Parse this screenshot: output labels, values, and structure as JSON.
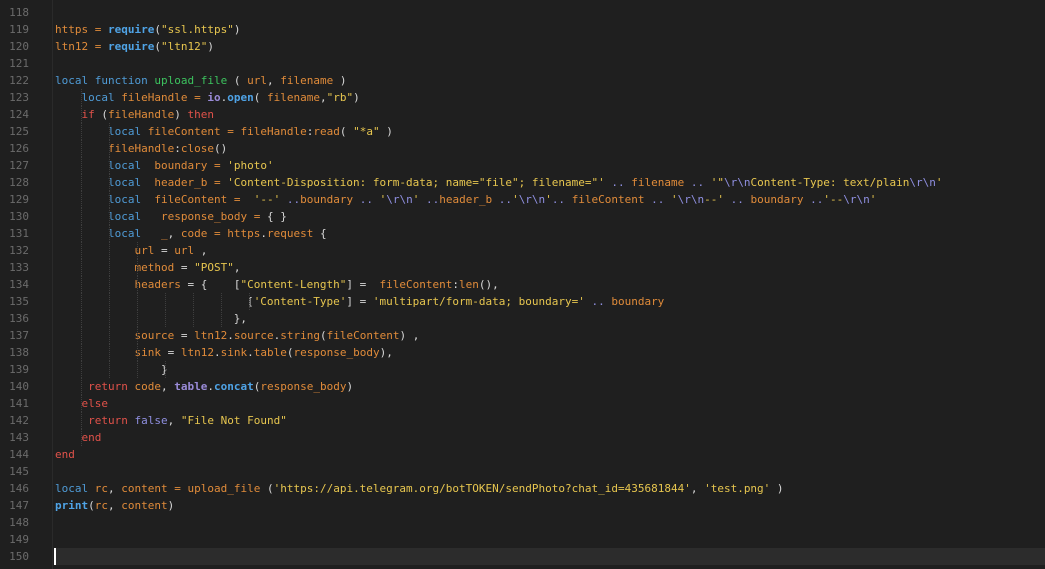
{
  "editor": {
    "language": "lua",
    "current_line": "150",
    "line_numbers": [
      "118",
      "119",
      "120",
      "121",
      "122",
      "123",
      "124",
      "125",
      "126",
      "127",
      "128",
      "129",
      "130",
      "131",
      "132",
      "133",
      "134",
      "135",
      "136",
      "137",
      "138",
      "139",
      "140",
      "141",
      "142",
      "143",
      "144",
      "145",
      "146",
      "147",
      "148",
      "149",
      "150"
    ],
    "token_colors": {
      "keyword": "#4f9bd6",
      "control_keyword": "#e0524a",
      "variable": "#e08b3a",
      "string": "#e7c64f",
      "function_name": "#3cc25e",
      "builtin": "#4fa3e6",
      "library": "#9a8bd8",
      "escape_and_concat": "#8f8fe0",
      "plain": "#d8d8d8"
    },
    "lines": [
      {
        "indent": 0,
        "tokens": []
      },
      {
        "indent": 0,
        "tokens": [
          [
            "var",
            "https"
          ],
          [
            "var",
            " = "
          ],
          [
            "bi",
            "require"
          ],
          [
            "plain",
            "("
          ],
          [
            "str",
            "\"ssl.https\""
          ],
          [
            "plain",
            ")"
          ]
        ]
      },
      {
        "indent": 0,
        "tokens": [
          [
            "var",
            "ltn12"
          ],
          [
            "var",
            " = "
          ],
          [
            "bi",
            "require"
          ],
          [
            "plain",
            "("
          ],
          [
            "str",
            "\"ltn12\""
          ],
          [
            "plain",
            ")"
          ]
        ]
      },
      {
        "indent": 0,
        "tokens": []
      },
      {
        "indent": 0,
        "tokens": [
          [
            "kw",
            "local"
          ],
          [
            "plain",
            " "
          ],
          [
            "kw",
            "function"
          ],
          [
            "plain",
            " "
          ],
          [
            "fn",
            "upload_file"
          ],
          [
            "plain",
            " ( "
          ],
          [
            "var",
            "url"
          ],
          [
            "plain",
            ", "
          ],
          [
            "var",
            "filename"
          ],
          [
            "plain",
            " )"
          ]
        ]
      },
      {
        "indent": 1,
        "tokens": [
          [
            "plain",
            "    "
          ],
          [
            "kw",
            "local"
          ],
          [
            "plain",
            " "
          ],
          [
            "var",
            "fileHandle"
          ],
          [
            "var",
            " = "
          ],
          [
            "lib",
            "io"
          ],
          [
            "plain",
            "."
          ],
          [
            "bi",
            "open"
          ],
          [
            "plain",
            "( "
          ],
          [
            "var",
            "filename"
          ],
          [
            "plain",
            ","
          ],
          [
            "str",
            "\"rb\""
          ],
          [
            "plain",
            ")"
          ]
        ]
      },
      {
        "indent": 1,
        "tokens": [
          [
            "plain",
            "    "
          ],
          [
            "kwr",
            "if"
          ],
          [
            "plain",
            " ("
          ],
          [
            "var",
            "fileHandle"
          ],
          [
            "plain",
            ") "
          ],
          [
            "kwr",
            "then"
          ]
        ]
      },
      {
        "indent": 2,
        "tokens": [
          [
            "plain",
            "        "
          ],
          [
            "kw",
            "local"
          ],
          [
            "plain",
            " "
          ],
          [
            "var",
            "fileContent"
          ],
          [
            "var",
            " = "
          ],
          [
            "var",
            "fileHandle"
          ],
          [
            "plain",
            ":"
          ],
          [
            "var",
            "read"
          ],
          [
            "plain",
            "( "
          ],
          [
            "str",
            "\"*a\""
          ],
          [
            "plain",
            " )"
          ]
        ]
      },
      {
        "indent": 2,
        "tokens": [
          [
            "plain",
            "        "
          ],
          [
            "var",
            "fileHandle"
          ],
          [
            "plain",
            ":"
          ],
          [
            "var",
            "close"
          ],
          [
            "plain",
            "()"
          ]
        ]
      },
      {
        "indent": 2,
        "tokens": [
          [
            "plain",
            "        "
          ],
          [
            "kw",
            "local"
          ],
          [
            "plain",
            "  "
          ],
          [
            "var",
            "boundary"
          ],
          [
            "var",
            " = "
          ],
          [
            "str",
            "'photo'"
          ]
        ]
      },
      {
        "indent": 2,
        "tokens": [
          [
            "plain",
            "        "
          ],
          [
            "kw",
            "local"
          ],
          [
            "plain",
            "  "
          ],
          [
            "var",
            "header_b"
          ],
          [
            "var",
            " = "
          ],
          [
            "str",
            "'Content-Disposition: form-data; name=\"file\"; filename=\"'"
          ],
          [
            "cat",
            " .. "
          ],
          [
            "var",
            "filename"
          ],
          [
            "cat",
            " .. "
          ],
          [
            "str",
            "'\""
          ],
          [
            "esc",
            "\\r\\n"
          ],
          [
            "str",
            "Content-Type: text/plain"
          ],
          [
            "esc",
            "\\r\\n"
          ],
          [
            "str",
            "'"
          ]
        ]
      },
      {
        "indent": 2,
        "tokens": [
          [
            "plain",
            "        "
          ],
          [
            "kw",
            "local"
          ],
          [
            "plain",
            "  "
          ],
          [
            "var",
            "fileContent"
          ],
          [
            "var",
            " =  "
          ],
          [
            "str",
            "'--'"
          ],
          [
            "cat",
            " .."
          ],
          [
            "var",
            "boundary"
          ],
          [
            "cat",
            " .. "
          ],
          [
            "str",
            "'"
          ],
          [
            "esc",
            "\\r\\n"
          ],
          [
            "str",
            "'"
          ],
          [
            "cat",
            " .."
          ],
          [
            "var",
            "header_b"
          ],
          [
            "cat",
            " .."
          ],
          [
            "str",
            "'"
          ],
          [
            "esc",
            "\\r\\n"
          ],
          [
            "str",
            "'"
          ],
          [
            "cat",
            ".. "
          ],
          [
            "var",
            "fileContent"
          ],
          [
            "cat",
            " .. "
          ],
          [
            "str",
            "'"
          ],
          [
            "esc",
            "\\r\\n"
          ],
          [
            "str",
            "--'"
          ],
          [
            "cat",
            " .. "
          ],
          [
            "var",
            "boundary"
          ],
          [
            "cat",
            " .."
          ],
          [
            "str",
            "'--"
          ],
          [
            "esc",
            "\\r\\n"
          ],
          [
            "str",
            "'"
          ]
        ]
      },
      {
        "indent": 2,
        "tokens": [
          [
            "plain",
            "        "
          ],
          [
            "kw",
            "local"
          ],
          [
            "plain",
            "   "
          ],
          [
            "var",
            "response_body"
          ],
          [
            "var",
            " = "
          ],
          [
            "plain",
            "{ }"
          ]
        ]
      },
      {
        "indent": 2,
        "tokens": [
          [
            "plain",
            "        "
          ],
          [
            "kw",
            "local"
          ],
          [
            "plain",
            "   "
          ],
          [
            "var",
            "_"
          ],
          [
            "plain",
            ", "
          ],
          [
            "var",
            "code"
          ],
          [
            "var",
            " = "
          ],
          [
            "var",
            "https"
          ],
          [
            "plain",
            "."
          ],
          [
            "var",
            "request"
          ],
          [
            "plain",
            " {"
          ]
        ]
      },
      {
        "indent": 3,
        "tokens": [
          [
            "plain",
            "            "
          ],
          [
            "var",
            "url"
          ],
          [
            "plain",
            " = "
          ],
          [
            "var",
            "url"
          ],
          [
            "plain",
            " ,"
          ]
        ]
      },
      {
        "indent": 3,
        "tokens": [
          [
            "plain",
            "            "
          ],
          [
            "var",
            "method"
          ],
          [
            "plain",
            " = "
          ],
          [
            "str",
            "\"POST\""
          ],
          [
            "plain",
            ","
          ]
        ]
      },
      {
        "indent": 3,
        "tokens": [
          [
            "plain",
            "            "
          ],
          [
            "var",
            "headers"
          ],
          [
            "plain",
            " = {    ["
          ],
          [
            "str",
            "\"Content-Length\""
          ],
          [
            "plain",
            "] =  "
          ],
          [
            "var",
            "fileContent"
          ],
          [
            "plain",
            ":"
          ],
          [
            "var",
            "len"
          ],
          [
            "plain",
            "(),"
          ]
        ]
      },
      {
        "indent": 7,
        "tokens": [
          [
            "plain",
            "                             ["
          ],
          [
            "str",
            "'Content-Type'"
          ],
          [
            "plain",
            "] = "
          ],
          [
            "str",
            "'multipart/form-data; boundary='"
          ],
          [
            "cat",
            " .. "
          ],
          [
            "var",
            "boundary"
          ]
        ]
      },
      {
        "indent": 6,
        "tokens": [
          [
            "plain",
            "                           },"
          ]
        ]
      },
      {
        "indent": 3,
        "tokens": [
          [
            "plain",
            "            "
          ],
          [
            "var",
            "source"
          ],
          [
            "plain",
            " = "
          ],
          [
            "var",
            "ltn12"
          ],
          [
            "plain",
            "."
          ],
          [
            "var",
            "source"
          ],
          [
            "plain",
            "."
          ],
          [
            "var",
            "string"
          ],
          [
            "plain",
            "("
          ],
          [
            "var",
            "fileContent"
          ],
          [
            "plain",
            ") ,"
          ]
        ]
      },
      {
        "indent": 3,
        "tokens": [
          [
            "plain",
            "            "
          ],
          [
            "var",
            "sink"
          ],
          [
            "plain",
            " = "
          ],
          [
            "var",
            "ltn12"
          ],
          [
            "plain",
            "."
          ],
          [
            "var",
            "sink"
          ],
          [
            "plain",
            "."
          ],
          [
            "var",
            "table"
          ],
          [
            "plain",
            "("
          ],
          [
            "var",
            "response_body"
          ],
          [
            "plain",
            "),"
          ]
        ]
      },
      {
        "indent": 4,
        "tokens": [
          [
            "plain",
            "                }"
          ]
        ]
      },
      {
        "indent": 1,
        "tokens": [
          [
            "plain",
            "     "
          ],
          [
            "kwr",
            "return"
          ],
          [
            "plain",
            " "
          ],
          [
            "var",
            "code"
          ],
          [
            "plain",
            ", "
          ],
          [
            "lib",
            "table"
          ],
          [
            "plain",
            "."
          ],
          [
            "bi",
            "concat"
          ],
          [
            "plain",
            "("
          ],
          [
            "var",
            "response_body"
          ],
          [
            "plain",
            ")"
          ]
        ]
      },
      {
        "indent": 1,
        "tokens": [
          [
            "plain",
            "    "
          ],
          [
            "kwr",
            "else"
          ]
        ]
      },
      {
        "indent": 1,
        "tokens": [
          [
            "plain",
            "     "
          ],
          [
            "kwr",
            "return"
          ],
          [
            "plain",
            " "
          ],
          [
            "nilk",
            "false"
          ],
          [
            "plain",
            ", "
          ],
          [
            "str",
            "\"File Not Found\""
          ]
        ]
      },
      {
        "indent": 1,
        "tokens": [
          [
            "plain",
            "    "
          ],
          [
            "kwr",
            "end"
          ]
        ]
      },
      {
        "indent": 0,
        "tokens": [
          [
            "kwr",
            "end"
          ]
        ]
      },
      {
        "indent": 0,
        "tokens": []
      },
      {
        "indent": 0,
        "tokens": [
          [
            "kw",
            "local"
          ],
          [
            "plain",
            " "
          ],
          [
            "var",
            "rc"
          ],
          [
            "plain",
            ", "
          ],
          [
            "var",
            "content"
          ],
          [
            "var",
            " = "
          ],
          [
            "var",
            "upload_file"
          ],
          [
            "plain",
            " ("
          ],
          [
            "str",
            "'https://api.telegram.org/botTOKEN/sendPhoto?chat_id=435681844'"
          ],
          [
            "plain",
            ", "
          ],
          [
            "str",
            "'test.png'"
          ],
          [
            "plain",
            " )"
          ]
        ]
      },
      {
        "indent": 0,
        "tokens": [
          [
            "bi",
            "print"
          ],
          [
            "plain",
            "("
          ],
          [
            "var",
            "rc"
          ],
          [
            "plain",
            ", "
          ],
          [
            "var",
            "content"
          ],
          [
            "plain",
            ")"
          ]
        ]
      },
      {
        "indent": 0,
        "tokens": []
      },
      {
        "indent": 0,
        "tokens": []
      },
      {
        "indent": 0,
        "tokens": []
      }
    ]
  }
}
